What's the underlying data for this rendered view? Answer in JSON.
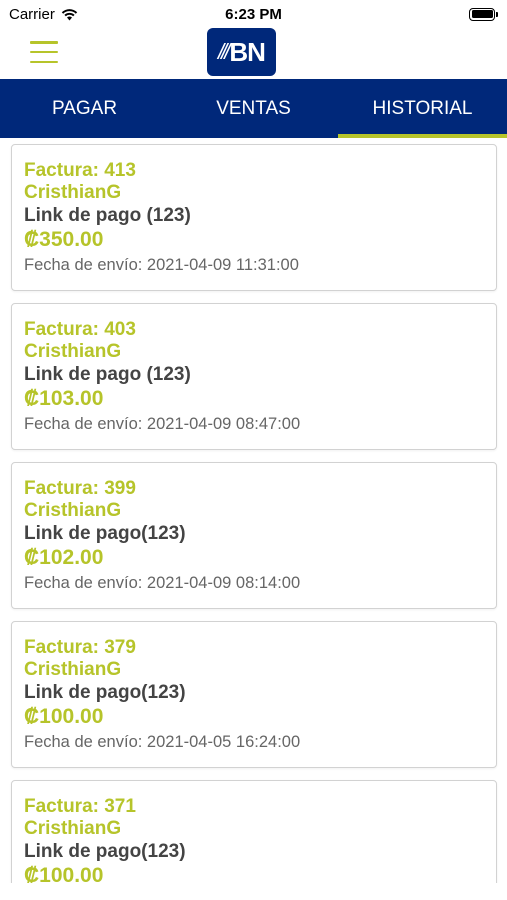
{
  "status_bar": {
    "carrier": "Carrier",
    "time": "6:23 PM"
  },
  "header": {
    "logo_text": "BN",
    "logo_stripes": "///",
    "brand_color": "#00287a",
    "accent_color": "#b6c42a"
  },
  "tabs": [
    {
      "label": "PAGAR",
      "active": false
    },
    {
      "label": "VENTAS",
      "active": false
    },
    {
      "label": "HISTORIAL",
      "active": true
    }
  ],
  "history": [
    {
      "invoice": "Factura: 413",
      "customer": "CristhianG",
      "link": "Link de pago (123)",
      "amount": "₡350.00",
      "date": "Fecha de envío: 2021-04-09 11:31:00"
    },
    {
      "invoice": "Factura: 403",
      "customer": "CristhianG",
      "link": "Link de pago (123)",
      "amount": "₡103.00",
      "date": "Fecha de envío: 2021-04-09 08:47:00"
    },
    {
      "invoice": "Factura: 399",
      "customer": "CristhianG",
      "link": "Link de pago(123)",
      "amount": "₡102.00",
      "date": "Fecha de envío: 2021-04-09 08:14:00"
    },
    {
      "invoice": "Factura: 379",
      "customer": "CristhianG",
      "link": "Link de pago(123)",
      "amount": "₡100.00",
      "date": "Fecha de envío: 2021-04-05 16:24:00"
    },
    {
      "invoice": "Factura: 371",
      "customer": "CristhianG",
      "link": "Link de pago(123)",
      "amount": "₡100.00",
      "date": ""
    }
  ]
}
